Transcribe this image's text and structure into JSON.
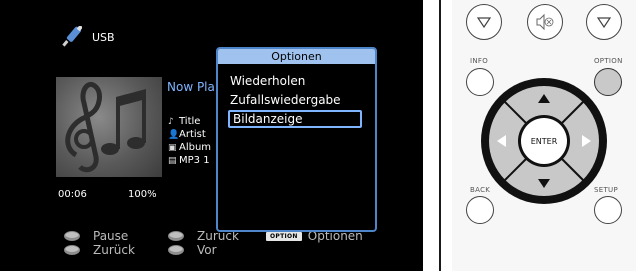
{
  "source": {
    "name": "USB",
    "icon": "usb-icon"
  },
  "player": {
    "now_playing": "Now Pla",
    "title": "Title",
    "artist": "Artist",
    "album": "Album",
    "format": "MP3 1",
    "time": "00:06",
    "progress_percent": "100%"
  },
  "options_popup": {
    "title": "Optionen",
    "items": [
      {
        "label": "Wiederholen",
        "selected": false
      },
      {
        "label": "Zufallswiedergabe",
        "selected": false
      },
      {
        "label": "Bildanzeige",
        "selected": true
      }
    ]
  },
  "hints": {
    "pause": "Pause",
    "back1": "Zurück",
    "back2": "Zurück",
    "back3": "Zurück",
    "next": "Vor",
    "option_chip": "OPTION",
    "options": "Optionen"
  },
  "remote": {
    "info_label": "INFO",
    "option_label": "OPTION",
    "back_label": "BACK",
    "setup_label": "SETUP",
    "enter_label": "ENTER"
  },
  "colors": {
    "popup_border": "#4e86c9",
    "popup_title_bg": "#9fc3ee",
    "highlight": "#7fb4ff",
    "dpad": "#c8c8c8"
  }
}
